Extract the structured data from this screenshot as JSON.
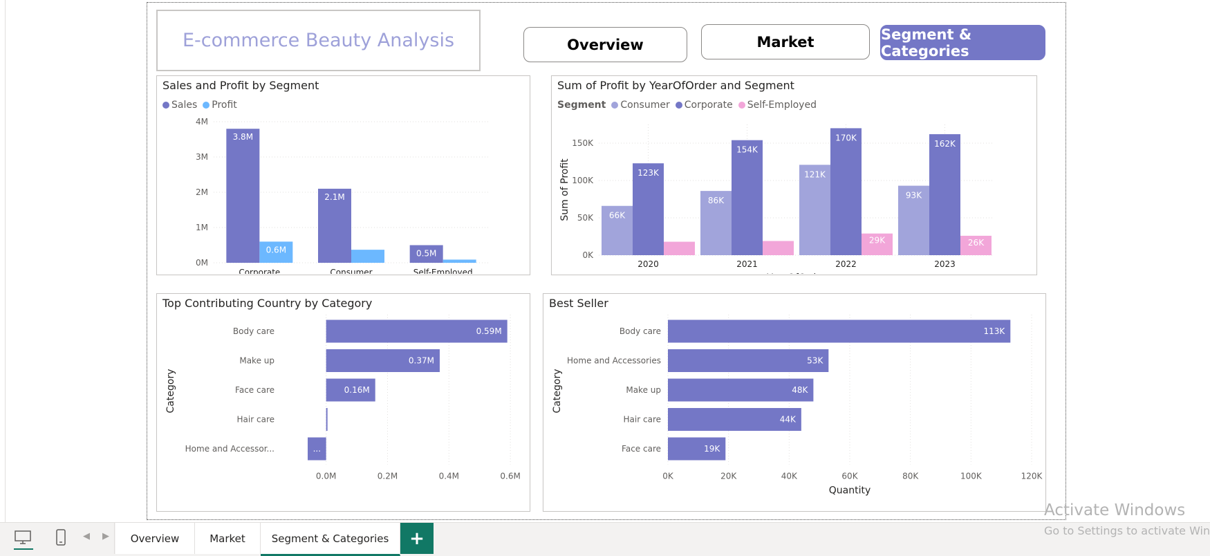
{
  "report_title": "E-commerce Beauty Analysis",
  "nav": {
    "overview": "Overview",
    "market": "Market",
    "segment": "Segment & Categories"
  },
  "colors": {
    "accent": "#7477c6",
    "consumer": "#a1a4db",
    "corporate": "#7477c6",
    "self_employed": "#f2a6d9",
    "profit": "#6cb8ff",
    "tab_green": "#117865"
  },
  "chart1": {
    "title": "Sales and Profit by Segment",
    "legend": [
      "Sales",
      "Profit"
    ]
  },
  "chart2": {
    "title": "Sum of Profit by YearOfOrder and Segment",
    "legend_title": "Segment",
    "legend": [
      "Consumer",
      "Corporate",
      "Self-Employed"
    ]
  },
  "chart3": {
    "title": "Top Contributing Country by Category"
  },
  "chart4": {
    "title": "Best Seller"
  },
  "chart_data": [
    {
      "type": "bar",
      "title": "Sales and Profit by Segment",
      "categories": [
        "Corporate",
        "Consumer",
        "Self-Employed"
      ],
      "series": [
        {
          "name": "Sales",
          "values": [
            3.8,
            2.1,
            0.5
          ],
          "labels": [
            "3.8M",
            "2.1M",
            "0.5M"
          ]
        },
        {
          "name": "Profit",
          "values": [
            0.6,
            0.37,
            0.09
          ],
          "labels": [
            "0.6M",
            "",
            ""
          ]
        }
      ],
      "yticks": [
        "0M",
        "1M",
        "2M",
        "3M",
        "4M"
      ],
      "ylim": [
        0,
        4
      ],
      "unit": "M",
      "grid": true,
      "legend_position": "top-left"
    },
    {
      "type": "bar",
      "title": "Sum of Profit by YearOfOrder and Segment",
      "xlabel": "YearOfOrder",
      "ylabel": "Sum of Profit",
      "categories": [
        "2020",
        "2021",
        "2022",
        "2023"
      ],
      "series": [
        {
          "name": "Consumer",
          "values": [
            66,
            86,
            121,
            93
          ],
          "labels": [
            "66K",
            "86K",
            "121K",
            "93K"
          ]
        },
        {
          "name": "Corporate",
          "values": [
            123,
            154,
            170,
            162
          ],
          "labels": [
            "123K",
            "154K",
            "170K",
            "162K"
          ]
        },
        {
          "name": "Self-Employed",
          "values": [
            18,
            19,
            29,
            26
          ],
          "labels": [
            "",
            "",
            "29K",
            "26K"
          ]
        }
      ],
      "yticks": [
        "0K",
        "50K",
        "100K",
        "150K"
      ],
      "ylim": [
        0,
        175
      ],
      "unit": "K",
      "grid": true,
      "legend_position": "top-left"
    },
    {
      "type": "bar",
      "orientation": "horizontal",
      "ylabel": "Category",
      "categories": [
        "Body care",
        "Make up",
        "Face care",
        "Hair care",
        "Home and Accessor..."
      ],
      "values": [
        0.59,
        0.37,
        0.16,
        0.003,
        -0.06
      ],
      "labels": [
        "0.59M",
        "0.37M",
        "0.16M",
        "",
        "..."
      ],
      "xticks": [
        "0.0M",
        "0.2M",
        "0.4M",
        "0.6M"
      ],
      "xlim": [
        -0.06,
        0.62
      ],
      "unit": "M",
      "grid": true
    },
    {
      "type": "bar",
      "orientation": "horizontal",
      "xlabel": "Quantity",
      "ylabel": "Category",
      "categories": [
        "Body care",
        "Home and Accessories",
        "Make up",
        "Hair care",
        "Face care"
      ],
      "values": [
        113,
        53,
        48,
        44,
        19
      ],
      "labels": [
        "113K",
        "53K",
        "48K",
        "44K",
        "19K"
      ],
      "xticks": [
        "0K",
        "20K",
        "40K",
        "60K",
        "80K",
        "100K",
        "120K"
      ],
      "xlim": [
        0,
        120
      ],
      "unit": "K",
      "grid": true
    }
  ],
  "tabs": [
    "Overview",
    "Market",
    "Segment & Categories"
  ],
  "add_tab": "+",
  "watermark": {
    "line1": "Activate Windows",
    "line2": "Go to Settings to activate Windows."
  }
}
